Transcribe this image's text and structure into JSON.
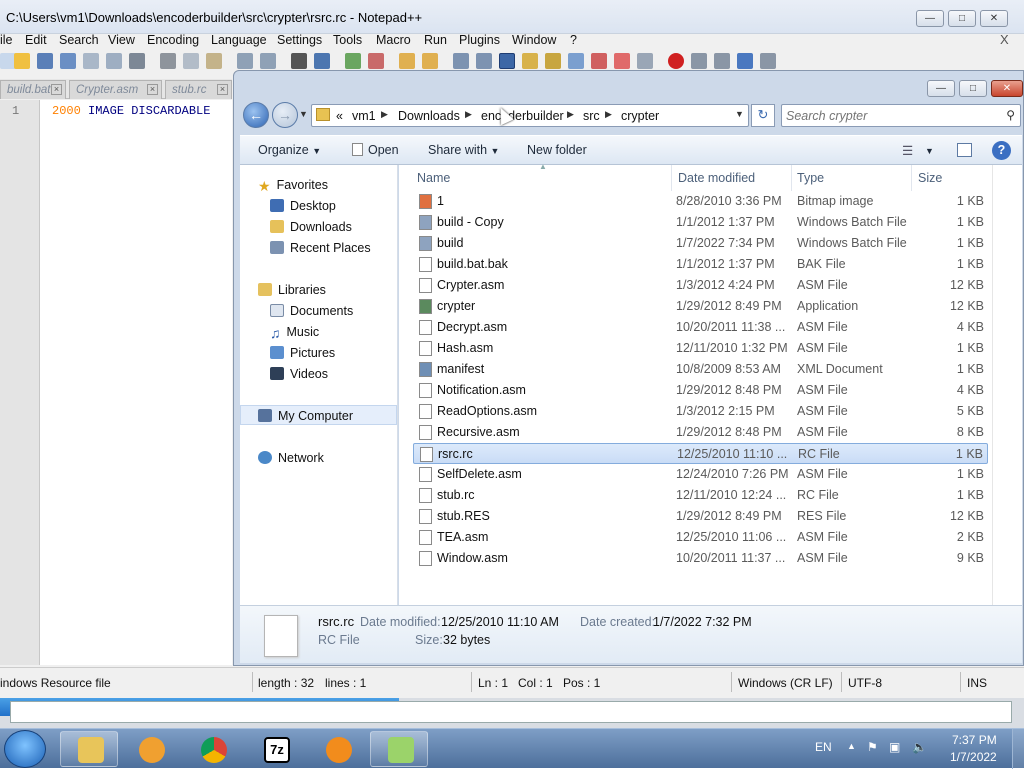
{
  "notepad": {
    "title": "C:\\Users\\vm1\\Downloads\\encoderbuilder\\src\\crypter\\rsrc.rc - Notepad++",
    "menu": [
      "ile",
      "Edit",
      "Search",
      "View",
      "Encoding",
      "Language",
      "Settings",
      "Tools",
      "Macro",
      "Run",
      "Plugins",
      "Window",
      "?"
    ],
    "menu_close": "X",
    "tabs": [
      "build.bat",
      "Crypter.asm",
      "stub.rc"
    ],
    "line_number": "1",
    "code": {
      "num": "2000",
      "kw1": "IMAGE",
      "kw2": "DISCARDABLE"
    },
    "status": {
      "filetype": "indows Resource file",
      "length": "length : 32",
      "lines": "lines : 1",
      "ln": "Ln : 1",
      "col": "Col : 1",
      "pos": "Pos : 1",
      "eol": "Windows (CR LF)",
      "encoding": "UTF-8",
      "mode": "INS"
    }
  },
  "explorer": {
    "breadcrumb": [
      "«",
      "vm1",
      "Downloads",
      "encoderbuilder",
      "src",
      "crypter"
    ],
    "search_placeholder": "Search crypter",
    "commands": {
      "organize": "Organize",
      "open": "Open",
      "share": "Share with",
      "new_folder": "New folder"
    },
    "nav": {
      "favorites": "Favorites",
      "desktop": "Desktop",
      "downloads": "Downloads",
      "recent": "Recent Places",
      "libraries": "Libraries",
      "documents": "Documents",
      "music": "Music",
      "pictures": "Pictures",
      "videos": "Videos",
      "computer": "My Computer",
      "network": "Network"
    },
    "columns": {
      "name": "Name",
      "date": "Date modified",
      "type": "Type",
      "size": "Size"
    },
    "files": [
      {
        "name": "1",
        "date": "8/28/2010 3:36 PM",
        "type": "Bitmap image",
        "size": "1 KB"
      },
      {
        "name": "build - Copy",
        "date": "1/1/2012 1:37 PM",
        "type": "Windows Batch File",
        "size": "1 KB"
      },
      {
        "name": "build",
        "date": "1/7/2022 7:34 PM",
        "type": "Windows Batch File",
        "size": "1 KB"
      },
      {
        "name": "build.bat.bak",
        "date": "1/1/2012 1:37 PM",
        "type": "BAK File",
        "size": "1 KB"
      },
      {
        "name": "Crypter.asm",
        "date": "1/3/2012 4:24 PM",
        "type": "ASM File",
        "size": "12 KB"
      },
      {
        "name": "crypter",
        "date": "1/29/2012 8:49 PM",
        "type": "Application",
        "size": "12 KB"
      },
      {
        "name": "Decrypt.asm",
        "date": "10/20/2011 11:38 ...",
        "type": "ASM File",
        "size": "4 KB"
      },
      {
        "name": "Hash.asm",
        "date": "12/11/2010 1:32 PM",
        "type": "ASM File",
        "size": "1 KB"
      },
      {
        "name": "manifest",
        "date": "10/8/2009 8:53 AM",
        "type": "XML Document",
        "size": "1 KB"
      },
      {
        "name": "Notification.asm",
        "date": "1/29/2012 8:48 PM",
        "type": "ASM File",
        "size": "4 KB"
      },
      {
        "name": "ReadOptions.asm",
        "date": "1/3/2012 2:15 PM",
        "type": "ASM File",
        "size": "5 KB"
      },
      {
        "name": "Recursive.asm",
        "date": "1/29/2012 8:48 PM",
        "type": "ASM File",
        "size": "8 KB"
      },
      {
        "name": "rsrc.rc",
        "date": "12/25/2010 11:10 ...",
        "type": "RC File",
        "size": "1 KB"
      },
      {
        "name": "SelfDelete.asm",
        "date": "12/24/2010 7:26 PM",
        "type": "ASM File",
        "size": "1 KB"
      },
      {
        "name": "stub.rc",
        "date": "12/11/2010 12:24 ...",
        "type": "RC File",
        "size": "1 KB"
      },
      {
        "name": "stub.RES",
        "date": "1/29/2012 8:49 PM",
        "type": "RES File",
        "size": "12 KB"
      },
      {
        "name": "TEA.asm",
        "date": "12/25/2010 11:06 ...",
        "type": "ASM File",
        "size": "2 KB"
      },
      {
        "name": "Window.asm",
        "date": "10/20/2011 11:37 ...",
        "type": "ASM File",
        "size": "9 KB"
      }
    ],
    "details": {
      "name": "rsrc.rc",
      "modified_label": "Date modified:",
      "modified": "12/25/2010 11:10 AM",
      "created_label": "Date created:",
      "created": "1/7/2022 7:32 PM",
      "type": "RC File",
      "size_label": "Size:",
      "size": "32 bytes"
    }
  },
  "taskbar": {
    "lang": "EN",
    "time": "7:37 PM",
    "date": "1/7/2022",
    "progress_fraction": 0.39
  }
}
